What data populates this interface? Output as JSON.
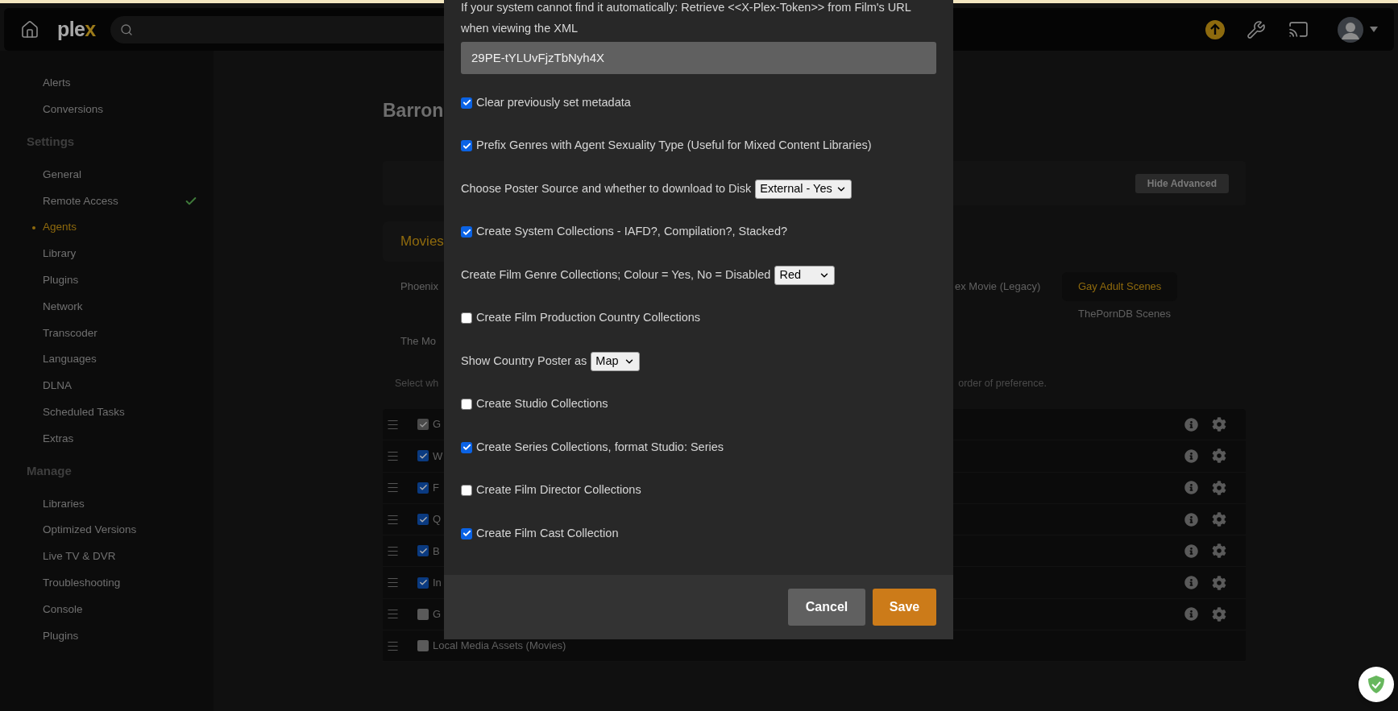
{
  "top_bar": {
    "logo": "plex"
  },
  "sidebar": {
    "sections": [
      {
        "items": [
          {
            "label": "Alerts",
            "selected": false,
            "ok": false
          },
          {
            "label": "Conversions",
            "selected": false,
            "ok": false
          }
        ]
      },
      {
        "title": "Settings",
        "items": [
          {
            "label": "General",
            "selected": false,
            "ok": false
          },
          {
            "label": "Remote Access",
            "selected": false,
            "ok": true
          },
          {
            "label": "Agents",
            "selected": true,
            "ok": false
          },
          {
            "label": "Library",
            "selected": false,
            "ok": false
          },
          {
            "label": "Plugins",
            "selected": false,
            "ok": false
          },
          {
            "label": "Network",
            "selected": false,
            "ok": false
          },
          {
            "label": "Transcoder",
            "selected": false,
            "ok": false
          },
          {
            "label": "Languages",
            "selected": false,
            "ok": false
          },
          {
            "label": "DLNA",
            "selected": false,
            "ok": false
          },
          {
            "label": "Scheduled Tasks",
            "selected": false,
            "ok": false
          },
          {
            "label": "Extras",
            "selected": false,
            "ok": false
          }
        ]
      },
      {
        "title": "Manage",
        "items": [
          {
            "label": "Libraries",
            "selected": false,
            "ok": false
          },
          {
            "label": "Optimized Versions",
            "selected": false,
            "ok": false
          },
          {
            "label": "Live TV & DVR",
            "selected": false,
            "ok": false
          },
          {
            "label": "Troubleshooting",
            "selected": false,
            "ok": false
          },
          {
            "label": "Console",
            "selected": false,
            "ok": false
          },
          {
            "label": "Plugins",
            "selected": false,
            "ok": false
          }
        ]
      }
    ]
  },
  "page": {
    "title": "Barron",
    "advanced_button": "Hide Advanced",
    "tab": "Movies",
    "agent_columns": [
      [
        {
          "label": "Phoenix",
          "selected": false
        },
        {
          "label": "The Mo",
          "selected": false
        }
      ],
      [
        {
          "label": "ex Movie (Legacy)",
          "selected": false
        }
      ],
      [
        {
          "label": "Gay Adult Scenes",
          "selected": true
        },
        {
          "label": "ThePornDB Scenes",
          "selected": false
        }
      ]
    ],
    "note_start": "Select wh",
    "note_end": "order of preference.",
    "agent_rows": [
      {
        "name": "G",
        "checked": true,
        "disabled": true,
        "actions": true
      },
      {
        "name": "W",
        "checked": true,
        "disabled": false,
        "actions": true
      },
      {
        "name": "F",
        "checked": true,
        "disabled": false,
        "actions": true
      },
      {
        "name": "Q",
        "checked": true,
        "disabled": false,
        "actions": true
      },
      {
        "name": "B",
        "checked": true,
        "disabled": false,
        "actions": true
      },
      {
        "name": "In",
        "checked": true,
        "disabled": false,
        "actions": true
      },
      {
        "name": "G",
        "checked": false,
        "disabled": false,
        "actions": true
      },
      {
        "name": "Local Media Assets (Movies)",
        "checked": false,
        "disabled": false,
        "actions": false
      }
    ]
  },
  "dialog": {
    "description": "If your system cannot find it automatically: Retrieve <<X-Plex-Token>> from Film's URL when viewing the XML",
    "token_field": {
      "value": "29PE-tYLUvFjzTbNyh4X"
    },
    "options": [
      {
        "kind": "checkbox",
        "label": "Clear previously set metadata",
        "checked": true
      },
      {
        "kind": "checkbox",
        "label": "Prefix Genres with Agent Sexuality Type (Useful for Mixed Content Libraries)",
        "checked": true
      },
      {
        "kind": "select",
        "label": "Choose Poster Source and whether to download to Disk",
        "value": "External - Yes"
      },
      {
        "kind": "checkbox",
        "label": "Create System Collections - IAFD?, Compilation?, Stacked?",
        "checked": true
      },
      {
        "kind": "select",
        "label": "Create Film Genre Collections; Colour = Yes, No = Disabled",
        "value": "Red"
      },
      {
        "kind": "checkbox",
        "label": "Create Film Production Country Collections",
        "checked": false
      },
      {
        "kind": "select",
        "label": "Show Country Poster as",
        "value": "Map"
      },
      {
        "kind": "checkbox",
        "label": "Create Studio Collections",
        "checked": false
      },
      {
        "kind": "checkbox",
        "label": "Create Series Collections, format Studio: Series",
        "checked": true
      },
      {
        "kind": "checkbox",
        "label": "Create Film Director Collections",
        "checked": false
      },
      {
        "kind": "checkbox",
        "label": "Create Film Cast Collection",
        "checked": true
      }
    ],
    "buttons": [
      {
        "label": "Cancel",
        "kind": "secondary"
      },
      {
        "label": "Save",
        "kind": "primary"
      }
    ]
  }
}
